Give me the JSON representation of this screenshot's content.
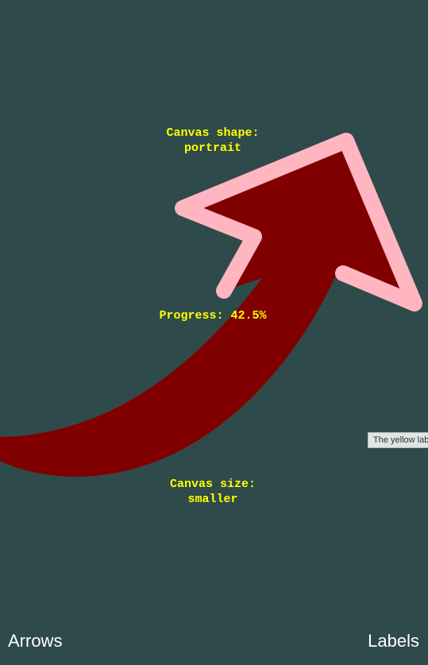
{
  "canvas": {
    "background": "#2f4a4a",
    "arrow_fill": "#800000",
    "arrow_outline": "#ffb6c1",
    "label_color": "#ffff00",
    "shape_title": "Canvas shape:",
    "shape_value": "portrait",
    "progress_text": "Progress: 42.5%",
    "progress_value": 42.5,
    "size_title": "Canvas size:",
    "size_value": "smaller"
  },
  "tooltip": {
    "text": "The yellow lab"
  },
  "nav": {
    "arrows_label": "Arrows",
    "labels_label": "Labels"
  }
}
